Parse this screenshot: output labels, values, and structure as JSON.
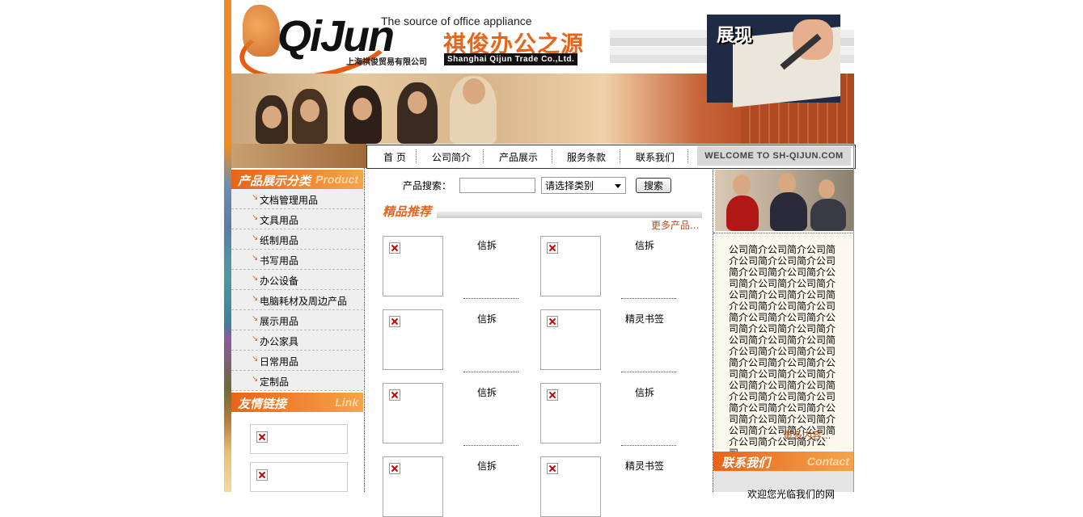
{
  "header": {
    "logo_brand": "QiJun",
    "logo_tagline": "The source of office appliance",
    "logo_cn": "祺俊办公之源",
    "logo_company_cn": "上海祺俊贸易有限公司",
    "logo_company_en": "Shanghai Qijun Trade Co.,Ltd.",
    "showcase_title": "展现"
  },
  "nav": {
    "items": [
      "首 页",
      "公司简介",
      "产品展示",
      "服务条款",
      "联系我们"
    ],
    "welcome": "WELCOME TO SH-QIJUN.COM"
  },
  "sidebar": {
    "category_title": "产品展示分类",
    "category_title_en": "Product",
    "categories": [
      "文档管理用品",
      "文具用品",
      "纸制用品",
      "书写用品",
      "办公设备",
      "电脑耗材及周边产品",
      "展示用品",
      "办公家具",
      "日常用品",
      "定制品"
    ],
    "links_title": "友情链接",
    "links_title_en": "Link"
  },
  "search": {
    "label": "产品搜索：",
    "input_value": "",
    "select_value": "请选择类别",
    "button": "搜索"
  },
  "recommend": {
    "title": "精品推荐",
    "more": "更多产品...",
    "products": [
      [
        "信拆",
        "信拆"
      ],
      [
        "信拆",
        "精灵书签"
      ],
      [
        "信拆",
        "信拆"
      ],
      [
        "信拆",
        "精灵书签"
      ]
    ]
  },
  "about": {
    "text": "公司简介公司简介公司简介公司简介公司简介公司简介公司简介公司简介公司简介公司简介公司简介公司简介公司简介公司简介公司简介公司简介公司简介公司简介公司简介公司简介公司简介公司简介公司简介公司简介公司简介公司简介公司简介公司简介公司简介公司简介公司简介公司简介公司简介公司简介公司简介公司简介公司简介公司简介公司简介公司简介公司简介公司简介公司简介公司简介公司简介公司简介公司简介公司简介公司简介公司...",
    "more": "更多内容..."
  },
  "contact": {
    "title": "联系我们",
    "title_en": "Contact",
    "text": "欢迎您光临我们的网"
  }
}
